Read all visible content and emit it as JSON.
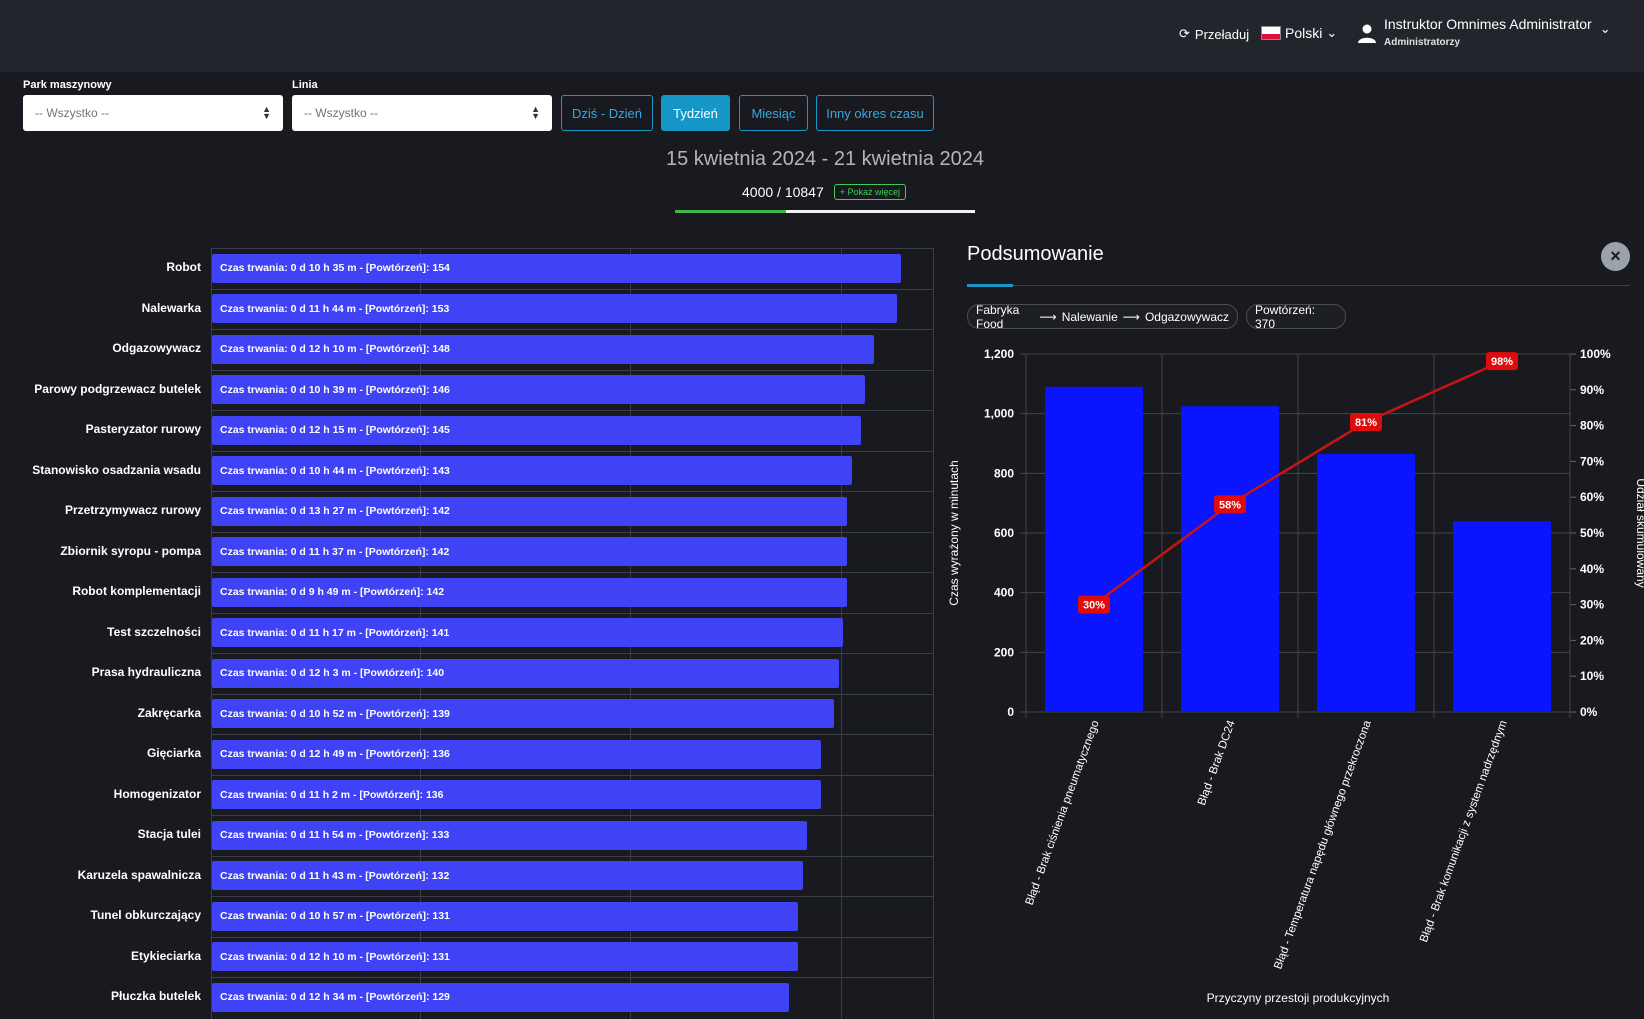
{
  "header": {
    "reload_label": "Przeładuj",
    "language_label": "Polski",
    "user_name": "Instruktor Omnimes Administrator",
    "user_role": "Administratorzy"
  },
  "filters": {
    "machine_park_label": "Park maszynowy",
    "machine_park_value": "-- Wszystko --",
    "line_label": "Linia",
    "line_value": "-- Wszystko --",
    "periods": [
      "Dziś - Dzień",
      "Tydzień",
      "Miesiąc",
      "Inny okres czasu"
    ],
    "active_period": "Tydzień"
  },
  "date_range": "15 kwietnia 2024 - 21 kwietnia 2024",
  "counter": {
    "text": "4000 / 10847",
    "show_more_label": "+ Pokaż więcej",
    "progress_fraction": 0.3688
  },
  "machines": [
    {
      "name": "Robot",
      "label": "Czas trwania: 0 d 10 h 35 m - [Powtórzeń]: 154",
      "count": 154
    },
    {
      "name": "Nalewarka",
      "label": "Czas trwania: 0 d 11 h 44 m - [Powtórzeń]: 153",
      "count": 153
    },
    {
      "name": "Odgazowywacz",
      "label": "Czas trwania: 0 d 12 h 10 m - [Powtórzeń]: 148",
      "count": 148
    },
    {
      "name": "Parowy podgrzewacz butelek",
      "label": "Czas trwania: 0 d 10 h 39 m - [Powtórzeń]: 146",
      "count": 146
    },
    {
      "name": "Pasteryzator rurowy",
      "label": "Czas trwania: 0 d 12 h 15 m - [Powtórzeń]: 145",
      "count": 145
    },
    {
      "name": "Stanowisko osadzania wsadu",
      "label": "Czas trwania: 0 d 10 h 44 m - [Powtórzeń]: 143",
      "count": 143
    },
    {
      "name": "Przetrzymywacz rurowy",
      "label": "Czas trwania: 0 d 13 h 27 m - [Powtórzeń]: 142",
      "count": 142
    },
    {
      "name": "Zbiornik syropu - pompa",
      "label": "Czas trwania: 0 d 11 h 37 m - [Powtórzeń]: 142",
      "count": 142
    },
    {
      "name": "Robot komplementacji",
      "label": "Czas trwania: 0 d 9 h 49 m - [Powtórzeń]: 142",
      "count": 142
    },
    {
      "name": "Test szczelności",
      "label": "Czas trwania: 0 d 11 h 17 m - [Powtórzeń]: 141",
      "count": 141
    },
    {
      "name": "Prasa hydrauliczna",
      "label": "Czas trwania: 0 d 12 h 3 m - [Powtórzeń]: 140",
      "count": 140
    },
    {
      "name": "Zakręcarka",
      "label": "Czas trwania: 0 d 10 h 52 m - [Powtórzeń]: 139",
      "count": 139
    },
    {
      "name": "Gięciarka",
      "label": "Czas trwania: 0 d 12 h 49 m - [Powtórzeń]: 136",
      "count": 136
    },
    {
      "name": "Homogenizator",
      "label": "Czas trwania: 0 d 11 h 2 m - [Powtórzeń]: 136",
      "count": 136
    },
    {
      "name": "Stacja tulei",
      "label": "Czas trwania: 0 d 11 h 54 m - [Powtórzeń]: 133",
      "count": 133
    },
    {
      "name": "Karuzela spawalnicza",
      "label": "Czas trwania: 0 d 11 h 43 m - [Powtórzeń]: 132",
      "count": 132
    },
    {
      "name": "Tunel obkurczający",
      "label": "Czas trwania: 0 d 10 h 57 m - [Powtórzeń]: 131",
      "count": 131
    },
    {
      "name": "Etykieciarka",
      "label": "Czas trwania: 0 d 12 h 10 m - [Powtórzeń]: 131",
      "count": 131
    },
    {
      "name": "Płuczka butelek",
      "label": "Czas trwania: 0 d 12 h 34 m - [Powtórzeń]: 129",
      "count": 129
    }
  ],
  "summary": {
    "title": "Podsumowanie",
    "breadcrumb": [
      "Fabryka Food",
      "Nalewanie",
      "Odgazowywacz"
    ],
    "repeats_label": "Powtórzeń: 370"
  },
  "chart_data": {
    "type": "bar",
    "categories": [
      "Błąd - Brak ciśnienia pneumatycznego",
      "Błąd - Brak DC24",
      "Błąd - Temperatura napędu głównego przekroczona",
      "Błąd - Brak komunikacji z system nadrzędnym"
    ],
    "series": [
      {
        "type": "bar",
        "values": [
          1090,
          1025,
          865,
          640
        ],
        "color": "#0a14ff"
      },
      {
        "type": "line",
        "values": [
          30,
          58,
          81,
          98
        ],
        "color": "#c81414",
        "axis": "right"
      }
    ],
    "point_labels": [
      "30%",
      "58%",
      "81%",
      "98%"
    ],
    "xlabel": "Przyczyny przestoji produkcyjnych",
    "ylabel": "Czas wyrażony w minutach",
    "y2label": "Udział skumulowany",
    "ylim": [
      0,
      1200
    ],
    "y2lim": [
      0,
      100
    ],
    "y_ticks": [
      "0",
      "200",
      "400",
      "600",
      "800",
      "1,000",
      "1,200"
    ],
    "y2_ticks": [
      "0%",
      "10%",
      "20%",
      "30%",
      "40%",
      "50%",
      "60%",
      "70%",
      "80%",
      "90%",
      "100%"
    ],
    "grid": true
  },
  "colors": {
    "bar": "#3f42f5",
    "accent": "#1a96c8",
    "pareto_bar": "#0a14ff",
    "pareto_line": "#c81414"
  }
}
